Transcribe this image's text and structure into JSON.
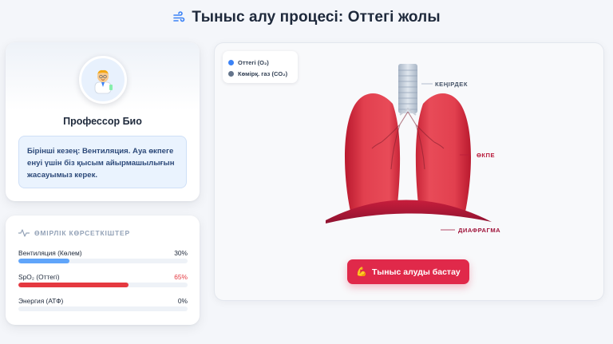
{
  "header": {
    "title": "Тыныс алу процесі: Оттегі жолы",
    "icon": "wind-icon"
  },
  "professor": {
    "name": "Профессор Био",
    "message": "Бірінші кезең: Вентиляция. Ауа өкпеге енуі үшін біз қысым айырмашылығын жасауымыз керек."
  },
  "vitals": {
    "title": "ӨМІРЛІК КӨРСЕТКІШТЕР",
    "items": [
      {
        "label": "Вентиляция (Көлем)",
        "value": "30%",
        "fraction": 0.3,
        "color": "#60a5fa",
        "value_color": "#1e293b"
      },
      {
        "label": "SpO₂ (Оттегі)",
        "value": "65%",
        "fraction": 0.65,
        "color": "#e53940",
        "value_color": "#e53940"
      },
      {
        "label": "Энергия (АТФ)",
        "value": "0%",
        "fraction": 0.0,
        "color": "#f59e0b",
        "value_color": "#1e293b"
      }
    ]
  },
  "legend": [
    {
      "label": "Оттегі (O₂)",
      "color": "#3b82f6"
    },
    {
      "label": "Көмірқ. газ (CO₂)",
      "color": "#64748b"
    }
  ],
  "diagram": {
    "labels": {
      "trachea": "КЕҢІРДЕК",
      "lung": "ӨКПЕ",
      "diaphragm": "ДИАФРАГМА"
    },
    "label_colors": {
      "trachea": "#475569",
      "lung": "#b91c3c",
      "diaphragm": "#9f1239"
    }
  },
  "actions": {
    "start_label": "Тыныс алуды бастау",
    "start_icon": "flexed-arm-icon"
  }
}
